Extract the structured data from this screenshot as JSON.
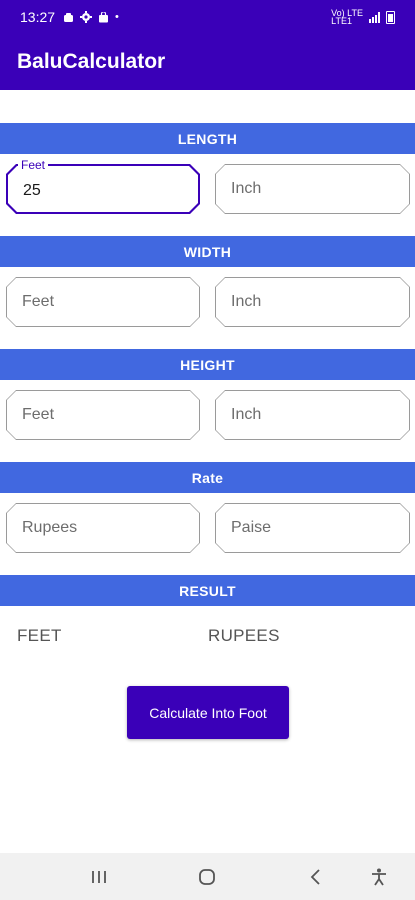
{
  "status_bar": {
    "time": "13:27",
    "left_icons": [
      "notification-icon",
      "settings-icon",
      "bag-icon"
    ],
    "dot": "•",
    "network_label": "Vo) LTE",
    "network_sublabel": "LTE1",
    "signal_icon": "signal-icon",
    "battery_icon": "battery-icon"
  },
  "app": {
    "title": "BaluCalculator"
  },
  "sections": {
    "length": {
      "header": "LENGTH",
      "feet": {
        "label": "Feet",
        "value": "25"
      },
      "inch": {
        "placeholder": "Inch"
      }
    },
    "width": {
      "header": "WIDTH",
      "feet": {
        "placeholder": "Feet"
      },
      "inch": {
        "placeholder": "Inch"
      }
    },
    "height": {
      "header": "HEIGHT",
      "feet": {
        "placeholder": "Feet"
      },
      "inch": {
        "placeholder": "Inch"
      }
    },
    "rate": {
      "header": "Rate",
      "rupees": {
        "placeholder": "Rupees"
      },
      "paise": {
        "placeholder": "Paise"
      }
    },
    "result": {
      "header": "RESULT",
      "feet_label": "FEET",
      "rupees_label": "RUPEES"
    }
  },
  "calculate_button": {
    "label": "Calculate Into Foot"
  },
  "nav_bar": {
    "icons": [
      "recent-apps-icon",
      "home-icon",
      "back-icon",
      "accessibility-icon"
    ]
  },
  "colors": {
    "primary": "#3a00b8",
    "section_header": "#4168e0"
  }
}
